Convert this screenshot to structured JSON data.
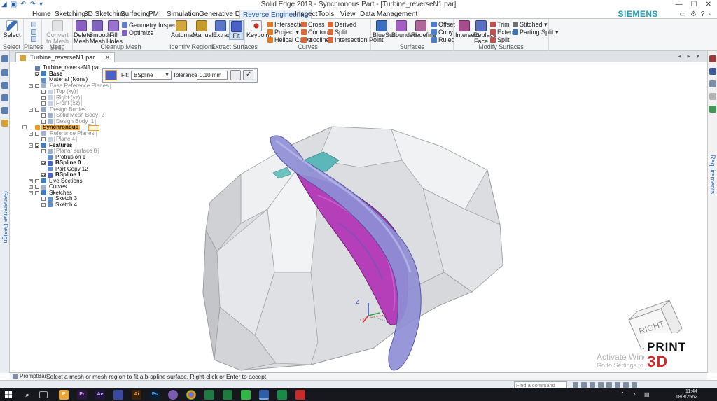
{
  "app": {
    "title": "Solid Edge 2019 - Synchronous Part - [Turbine_reverseN1.par]",
    "brand": "SIEMENS",
    "colors": {
      "accent": "#1a4f9c",
      "brand": "#1f9fb4",
      "selection": "#f6b34a"
    }
  },
  "ribbon": {
    "tabs": [
      {
        "label": "Home",
        "active": false
      },
      {
        "label": "Sketching",
        "active": false
      },
      {
        "label": "3D Sketching",
        "active": false
      },
      {
        "label": "Surfacing",
        "active": false
      },
      {
        "label": "PMI",
        "active": false
      },
      {
        "label": "Simulation",
        "active": false
      },
      {
        "label": "Generative Design",
        "active": false
      },
      {
        "label": "Reverse Engineering",
        "active": true
      },
      {
        "label": "Inspect",
        "active": false
      },
      {
        "label": "Tools",
        "active": false
      },
      {
        "label": "View",
        "active": false
      },
      {
        "label": "Data Management",
        "active": false
      }
    ],
    "groups": {
      "select": {
        "label": "Select",
        "btn": "Select"
      },
      "planes": {
        "label": "Planes"
      },
      "mesh": {
        "label": "Mesh",
        "convert": "Convert to Mesh Body"
      },
      "cleanup": {
        "label": "Cleanup Mesh",
        "delete": "Delete Mesh",
        "smooth": "Smooth Mesh",
        "fill": "Fill Holes",
        "geometry": "Geometry Inspector",
        "optimize": "Optimize"
      },
      "identify": {
        "label": "Identify Regions",
        "automatic": "Automatic",
        "manual": "Manual"
      },
      "extract": {
        "label": "Extract Surfaces",
        "extract": "Extract",
        "fit": "Fit"
      },
      "curves": {
        "label": "Curves",
        "keypoint": "Keypoint",
        "intersection": "Intersection",
        "project": "Project",
        "helical": "Helical Curve",
        "cross": "Cross",
        "contour": "Contour",
        "isocline": "Isocline",
        "derived": "Derived",
        "split": "Split",
        "intersection_point": "Intersection Point"
      },
      "surfaces": {
        "label": "Surfaces",
        "bluesurf": "BlueSurf",
        "bounded": "Bounded",
        "redefine": "Redefine",
        "offset": "Offset",
        "copy": "Copy",
        "ruled": "Ruled"
      },
      "modify": {
        "label": "Modify Surfaces",
        "intersect": "Intersect",
        "replace": "Replace Face",
        "trim": "Trim",
        "extend": "Extend",
        "split": "Split",
        "stitched": "Stitched",
        "parting": "Parting Split"
      }
    }
  },
  "sidebar": {
    "left_label": "Generative Design",
    "right_label": "Requirements"
  },
  "document": {
    "tab": "Turbine_reverseN1.par"
  },
  "tree": [
    {
      "label": "Turbine_reverseN1.par",
      "level": 0,
      "exp": "",
      "chk": null,
      "icon": "#6a7fa8",
      "style": ""
    },
    {
      "label": "Base",
      "level": 1,
      "exp": "",
      "chk": "on",
      "icon": "#3c7cc8",
      "style": "bold"
    },
    {
      "label": "Material (None)",
      "level": 1,
      "exp": "",
      "chk": null,
      "icon": "#5f8fd0",
      "style": ""
    },
    {
      "label": "Base Reference Planes",
      "level": 1,
      "exp": "-",
      "chk": "off",
      "icon": "#9fb3d0",
      "style": "dim"
    },
    {
      "label": "Top (xy)",
      "level": 2,
      "exp": "",
      "chk": "off",
      "icon": "#c7d2e2",
      "style": "dim"
    },
    {
      "label": "Right (yz)",
      "level": 2,
      "exp": "",
      "chk": "off",
      "icon": "#c7d2e2",
      "style": "dim"
    },
    {
      "label": "Front (xz)",
      "level": 2,
      "exp": "",
      "chk": "off",
      "icon": "#c7d2e2",
      "style": "dim"
    },
    {
      "label": "Design Bodies",
      "level": 1,
      "exp": "-",
      "chk": "off",
      "icon": "#8fa5c8",
      "style": "dim"
    },
    {
      "label": "Solid Mesh Body_2",
      "level": 2,
      "exp": "",
      "chk": "off",
      "icon": "#a0b4d2",
      "style": "dim"
    },
    {
      "label": "Design Body_1",
      "level": 2,
      "exp": "",
      "chk": "off",
      "icon": "#a0b4d2",
      "style": "dim"
    },
    {
      "label": "Synchronous",
      "level": 0,
      "exp": "-",
      "chk": null,
      "icon": "#f19b1f",
      "style": "hl"
    },
    {
      "label": "Reference Planes",
      "level": 1,
      "exp": "-",
      "chk": "off",
      "icon": "#9fb3d0",
      "style": "dim"
    },
    {
      "label": "Plane 4",
      "level": 2,
      "exp": "",
      "chk": "off",
      "icon": "#c7d2e2",
      "style": "dim"
    },
    {
      "label": "Features",
      "level": 1,
      "exp": "-",
      "chk": "on",
      "icon": "#3c7cc8",
      "style": "bold"
    },
    {
      "label": "Planar surface 0",
      "level": 2,
      "exp": "",
      "chk": "off",
      "icon": "#9fb3d0",
      "style": "dim"
    },
    {
      "label": "Protrusion 1",
      "level": 2,
      "exp": "",
      "chk": null,
      "icon": "#5f8fd0",
      "style": ""
    },
    {
      "label": "BSpline 0",
      "level": 2,
      "exp": "",
      "chk": "on",
      "icon": "#4a61c7",
      "style": "bold"
    },
    {
      "label": "Part Copy 12",
      "level": 2,
      "exp": "",
      "chk": null,
      "icon": "#5f8fd0",
      "style": ""
    },
    {
      "label": "BSpline 1",
      "level": 2,
      "exp": "",
      "chk": "on",
      "icon": "#4a61c7",
      "style": "bold"
    },
    {
      "label": "Live Sections",
      "level": 1,
      "exp": "+",
      "chk": "off",
      "icon": "#3c7cc8",
      "style": ""
    },
    {
      "label": "Curves",
      "level": 1,
      "exp": "+",
      "chk": "off",
      "icon": "#9fb3d0",
      "style": ""
    },
    {
      "label": "Sketches",
      "level": 1,
      "exp": "-",
      "chk": "off",
      "icon": "#3c7cc8",
      "style": ""
    },
    {
      "label": "Sketch 3",
      "level": 2,
      "exp": "",
      "chk": "off",
      "icon": "#5f8fd0",
      "style": ""
    },
    {
      "label": "Sketch 4",
      "level": 2,
      "exp": "",
      "chk": "off",
      "icon": "#5f8fd0",
      "style": ""
    }
  ],
  "command_bar": {
    "fit_label": "Fit:",
    "fit_value": "BSpline",
    "tolerance_label": "Tolerance:",
    "tolerance_value": "0.10 mm"
  },
  "viewport": {
    "viewcube_label": "RIGHT",
    "axis_z": "Z",
    "watermark_line1": "Activate Windows",
    "watermark_line2": "Go to Settings to activate Windows.",
    "logo_line1": "PRINT",
    "logo_line2": "3D"
  },
  "prompt": {
    "tab": "PromptBar",
    "text": "Select a mesh or mesh region to fit a b-spline surface. Right-click or Enter to accept."
  },
  "status": {
    "find_placeholder": "Find a command"
  },
  "taskbar": {
    "time": "11:44",
    "date": "18/3/2562"
  }
}
